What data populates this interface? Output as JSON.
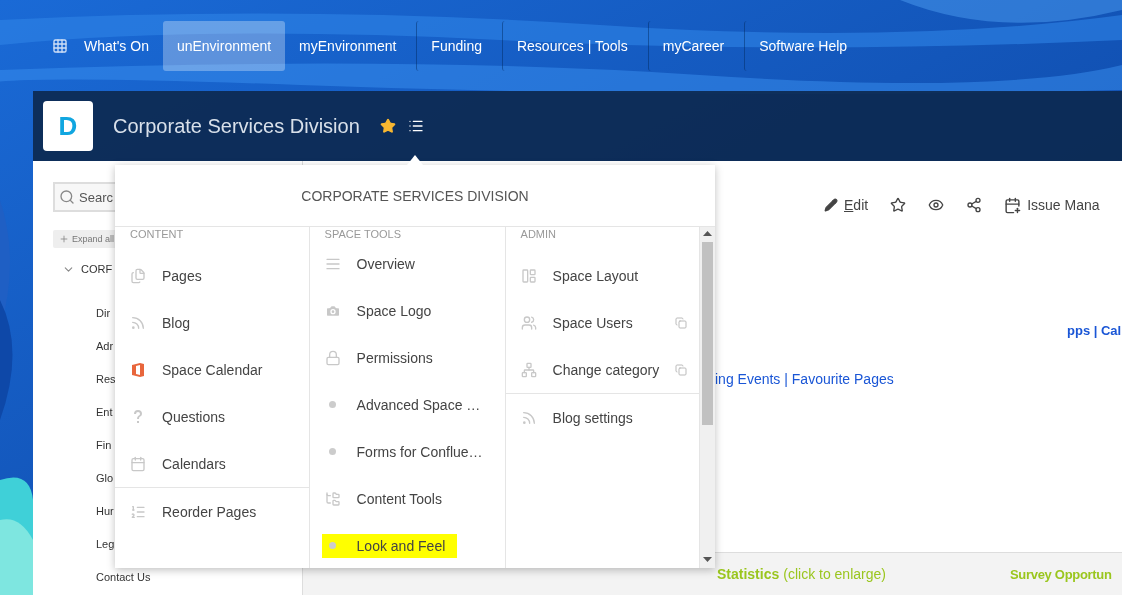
{
  "top_nav": [
    {
      "label": "What's On",
      "selected": false
    },
    {
      "label": "unEnvironment",
      "selected": true
    },
    {
      "label": "myEnvironment",
      "selected": false
    },
    {
      "label": "Funding",
      "selected": false
    },
    {
      "label": "Resources | Tools",
      "selected": false
    },
    {
      "label": "myCareer",
      "selected": false
    },
    {
      "label": "Software Help",
      "selected": false
    }
  ],
  "space_header": {
    "logo_letter": "D",
    "title": "Corporate Services Division"
  },
  "sidebar": {
    "search": {
      "placeholder": "Searc"
    },
    "expand_button": "Expand all",
    "tree": {
      "label": "CORF",
      "expanded": true,
      "children": [
        "Dir",
        "Adr",
        "Res",
        "Ent",
        "Fin",
        "Glo",
        "Hur",
        "Leg",
        "Contact Us"
      ]
    }
  },
  "page_toolbar": {
    "edit": "Edit",
    "issue_button": "Issue Mana"
  },
  "content": {
    "links_line_1": "pps | Cal",
    "links_line_2": "ing Events | Favourite Pages"
  },
  "bottom_bar": {
    "statistics_title": "Statistics",
    "statistics_hint": "(click to enlarge)",
    "survey_title": "Survey Opportun"
  },
  "space_menu": {
    "title": "CORPORATE SERVICES DIVISION",
    "columns": [
      {
        "heading": "CONTENT",
        "groups": [
          [
            {
              "label": "Pages"
            },
            {
              "label": "Blog"
            },
            {
              "label": "Space Calendar"
            },
            {
              "label": "Questions"
            },
            {
              "label": "Calendars"
            }
          ],
          [
            {
              "label": "Reorder Pages"
            }
          ]
        ]
      },
      {
        "heading": "SPACE TOOLS",
        "groups": [
          [
            {
              "label": "Overview",
              "highlighted": false
            },
            {
              "label": "Space Logo",
              "highlighted": false
            },
            {
              "label": "Permissions",
              "highlighted": false
            },
            {
              "label": "Advanced Space …",
              "highlighted": false
            },
            {
              "label": "Forms for Conflue…",
              "highlighted": false
            },
            {
              "label": "Content Tools",
              "highlighted": false
            },
            {
              "label": "Look and Feel",
              "highlighted": true
            }
          ]
        ]
      },
      {
        "heading": "ADMIN",
        "groups": [
          [
            {
              "label": "Space Layout",
              "external": false
            },
            {
              "label": "Space Users",
              "external": true
            },
            {
              "label": "Change category",
              "external": true
            }
          ],
          [
            {
              "label": "Blog settings",
              "external": false
            }
          ]
        ]
      }
    ]
  }
}
